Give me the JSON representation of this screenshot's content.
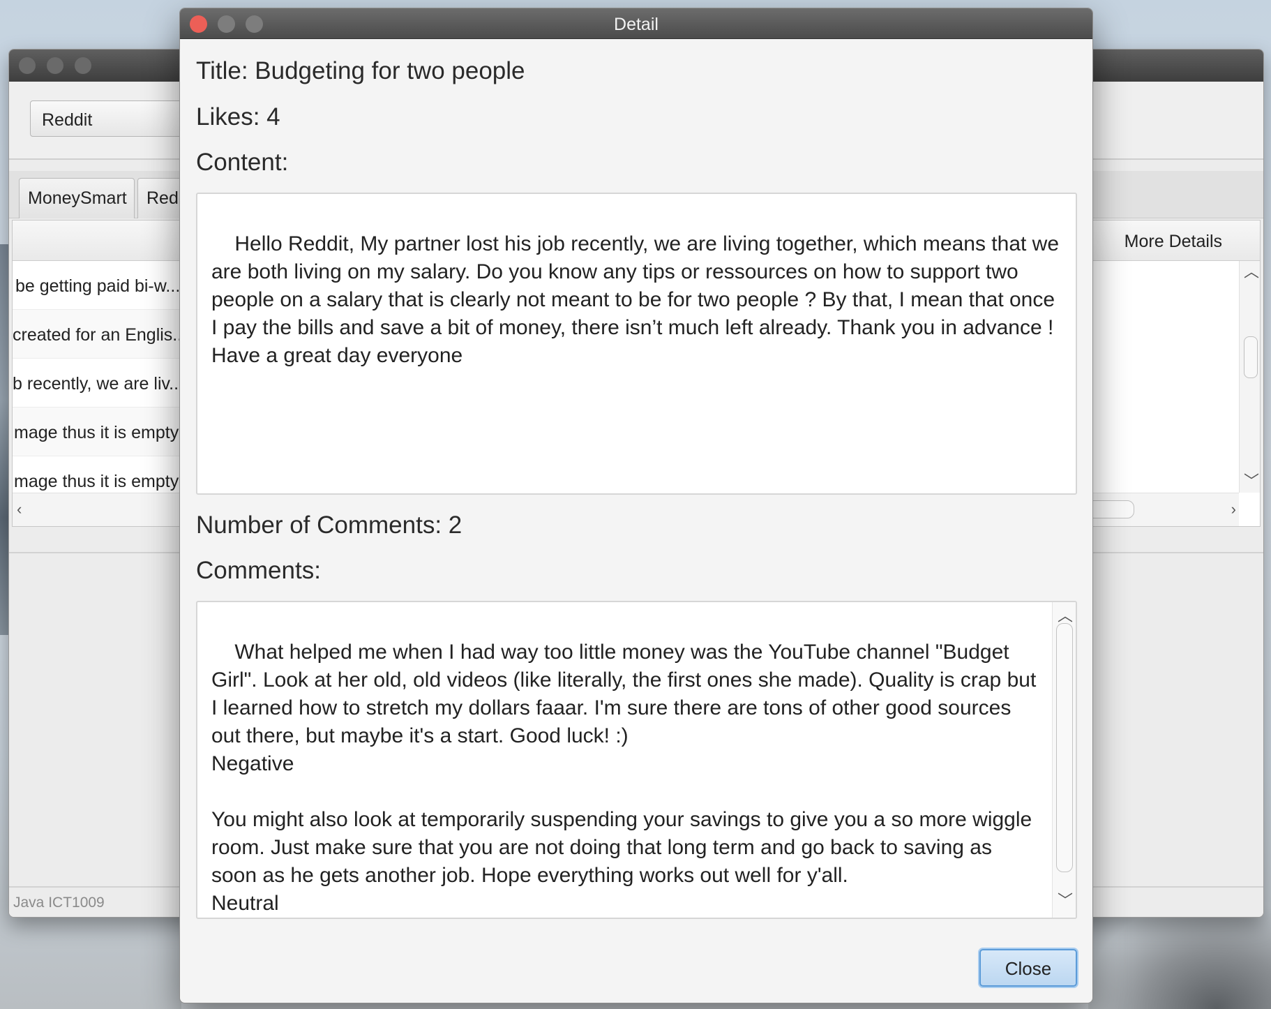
{
  "back_window": {
    "source_select": "Reddit",
    "tabs": [
      "MoneySmart",
      "Redd"
    ],
    "table": {
      "column_more_details": "More Details",
      "rows": [
        "be getting paid bi-w...",
        "created for an Englis...",
        "b recently, we are liv...",
        "mage thus it is empty",
        "mage thus it is empty"
      ]
    },
    "status": "Java ICT1009"
  },
  "dialog": {
    "window_title": "Detail",
    "title_line": "Title: Budgeting for two people",
    "likes_line": "Likes: 4",
    "content_label": "Content:",
    "content_text": "Hello Reddit, My partner lost his job recently, we are living together, which means that we are both living on my salary. Do you know any tips or ressources on how to support two people on a salary that is clearly not meant to be for two people ? By that, I mean that once I pay the bills and save a bit of money, there isn’t much left already. Thank you in advance !\nHave a great day everyone",
    "comments_count_line": "Number of Comments: 2",
    "comments_label": "Comments:",
    "comments_text": "What helped me when I had way too little money was the YouTube channel \"Budget Girl\". Look at her old, old videos (like literally, the first ones she made). Quality is crap but I learned how to stretch my dollars faaar. I'm sure there are tons of other good sources out there, but maybe it's a start. Good luck! :)\nNegative\n\nYou might also look at temporarily suspending your savings to give you a so more wiggle room. Just make sure that you are not doing that long term and go back to saving as soon as he gets another job. Hope everything works out well for y'all.\nNeutral",
    "close_label": "Close"
  },
  "colors": {
    "close_dot": "#ec5f57",
    "inactive_dot": "#7d7d7d",
    "button_focus": "#5b9bd8"
  }
}
